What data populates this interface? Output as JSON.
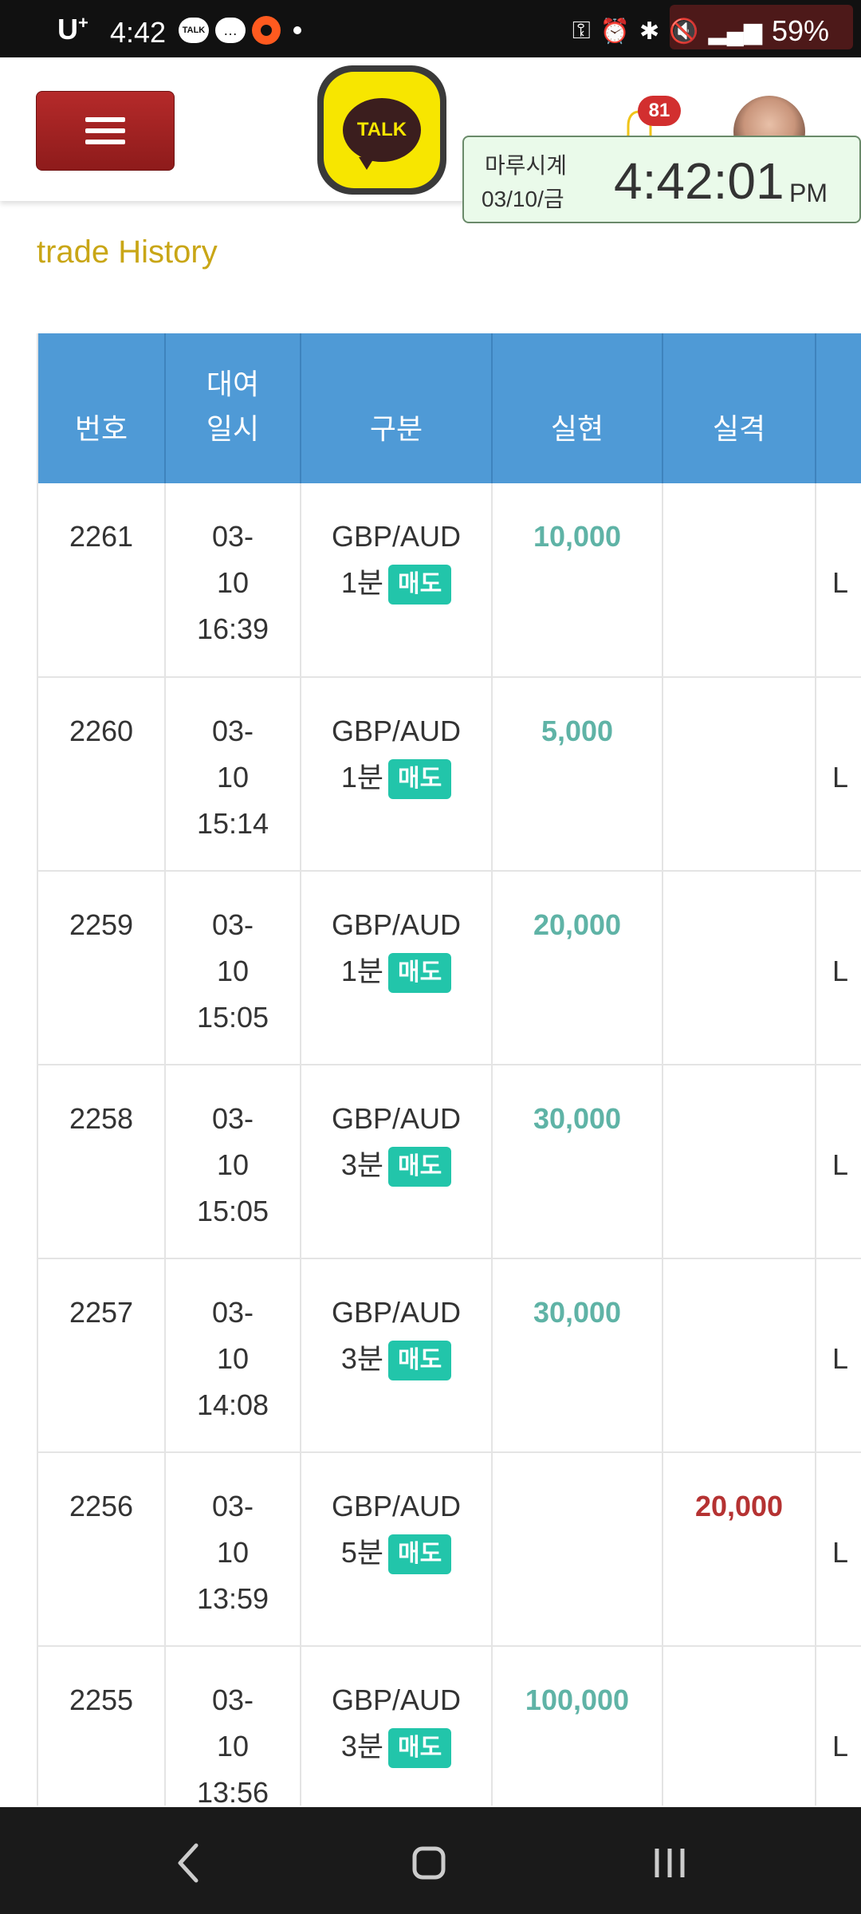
{
  "status_bar": {
    "carrier": "U",
    "carrier_sup": "+",
    "time": "4:42",
    "talk_chip": "TALK",
    "battery": "59%"
  },
  "header": {
    "talk_logo_text": "TALK",
    "notification_count": "81",
    "clock": {
      "label": "마루시계",
      "date": "03/10/금",
      "time": "4:42:01",
      "ampm": "PM"
    }
  },
  "page": {
    "subtitle": "trade History"
  },
  "table": {
    "headers": {
      "no": "번호",
      "date_line1": "대여",
      "date_line2": "일시",
      "type": "구분",
      "realized": "실현",
      "loss": "실격"
    },
    "rows": [
      {
        "no": "2261",
        "date": "03-",
        "day": "10",
        "time": "16:39",
        "pair": "GBP/AUD",
        "period": "1분",
        "side": "매도",
        "realized": "10,000",
        "loss": "",
        "extra": "L"
      },
      {
        "no": "2260",
        "date": "03-",
        "day": "10",
        "time": "15:14",
        "pair": "GBP/AUD",
        "period": "1분",
        "side": "매도",
        "realized": "5,000",
        "loss": "",
        "extra": "L"
      },
      {
        "no": "2259",
        "date": "03-",
        "day": "10",
        "time": "15:05",
        "pair": "GBP/AUD",
        "period": "1분",
        "side": "매도",
        "realized": "20,000",
        "loss": "",
        "extra": "L"
      },
      {
        "no": "2258",
        "date": "03-",
        "day": "10",
        "time": "15:05",
        "pair": "GBP/AUD",
        "period": "3분",
        "side": "매도",
        "realized": "30,000",
        "loss": "",
        "extra": "L"
      },
      {
        "no": "2257",
        "date": "03-",
        "day": "10",
        "time": "14:08",
        "pair": "GBP/AUD",
        "period": "3분",
        "side": "매도",
        "realized": "30,000",
        "loss": "",
        "extra": "L"
      },
      {
        "no": "2256",
        "date": "03-",
        "day": "10",
        "time": "13:59",
        "pair": "GBP/AUD",
        "period": "5분",
        "side": "매도",
        "realized": "",
        "loss": "20,000",
        "extra": "L"
      },
      {
        "no": "2255",
        "date": "03-",
        "day": "10",
        "time": "13:56",
        "pair": "GBP/AUD",
        "period": "3분",
        "side": "매도",
        "realized": "100,000",
        "loss": "",
        "extra": "L"
      }
    ]
  },
  "colors": {
    "header_blue": "#4f9ad6",
    "sell_badge": "#22c5aa",
    "realized_text": "#5fb3a6",
    "loss_text": "#b53232",
    "menu_red": "#a52222",
    "subtitle_gold": "#c9a616"
  },
  "icons": {
    "menu": "hamburger-icon",
    "bell": "bell-icon",
    "nav_back": "back-icon",
    "nav_home": "home-icon",
    "nav_recent": "recent-apps-icon"
  }
}
